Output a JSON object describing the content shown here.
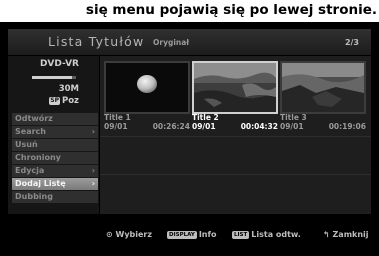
{
  "caption": "się menu pojawią się po lewej stronie.",
  "header": {
    "title": "Lista Tytułów",
    "subtitle": "Oryginał",
    "page": "2/3"
  },
  "disc": {
    "type": "DVD-VR",
    "remaining": "30M",
    "mode_badge": "SP",
    "mode": "Poz",
    "fill_fraction": 0.9
  },
  "menu": {
    "items": [
      {
        "label": "Odtwórz",
        "chevron": ""
      },
      {
        "label": "Search",
        "chevron": "›"
      },
      {
        "label": "Usuń",
        "chevron": ""
      },
      {
        "label": "Chroniony",
        "chevron": ""
      },
      {
        "label": "Edycja",
        "chevron": "›"
      },
      {
        "label": "Dodaj Listę",
        "chevron": "›"
      },
      {
        "label": "Dubbing",
        "chevron": ""
      }
    ],
    "active_index": 5
  },
  "titles": [
    {
      "name": "Title 1",
      "date": "09/01",
      "duration": "00:26:24"
    },
    {
      "name": "Title 2",
      "date": "09/01",
      "duration": "00:04:32"
    },
    {
      "name": "Title 3",
      "date": "09/01",
      "duration": "00:19:06"
    }
  ],
  "selected_title_index": 1,
  "footer": {
    "select_label": "Wybierz",
    "display_key": "DISPLAY",
    "info_label": "Info",
    "list_key": "LIST",
    "list_label": "Lista odtw.",
    "close_label": "Zamknij"
  },
  "colors": {
    "background": "#000000",
    "selected_border": "#d0d0d0",
    "menu_active": "#8c8c8c"
  }
}
